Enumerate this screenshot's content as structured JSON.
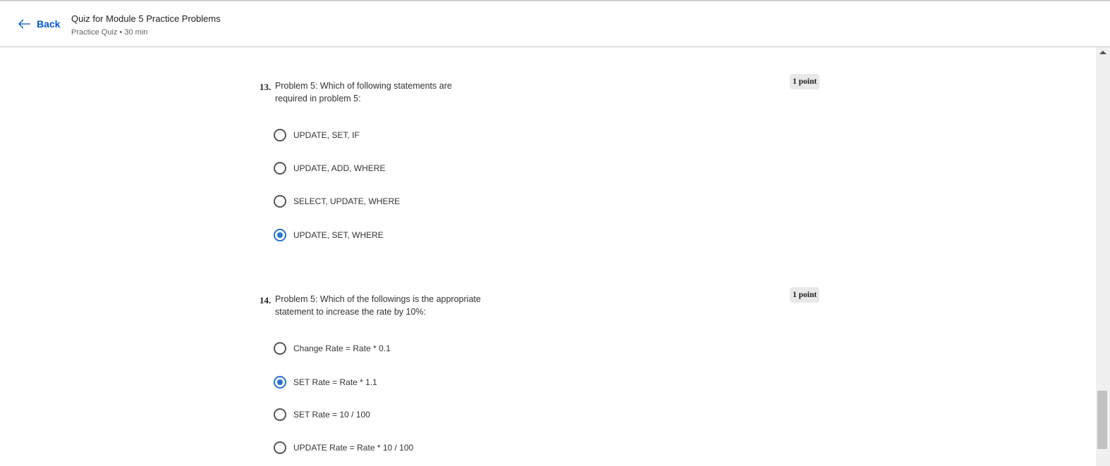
{
  "header": {
    "back_label": "Back",
    "title": "Quiz for Module 5 Practice Problems",
    "subtitle": "Practice Quiz • 30 min"
  },
  "questions": [
    {
      "number": "13.",
      "text": "Problem 5: Which of following statements are required in problem 5:",
      "points": "1 point",
      "options": [
        {
          "label": "UPDATE, SET, IF",
          "selected": false
        },
        {
          "label": "UPDATE, ADD, WHERE",
          "selected": false
        },
        {
          "label": "SELECT, UPDATE, WHERE",
          "selected": false
        },
        {
          "label": "UPDATE, SET, WHERE",
          "selected": true
        }
      ]
    },
    {
      "number": "14.",
      "text": "Problem 5: Which of the followings is the appropriate statement to increase the rate by 10%:",
      "points": "1 point",
      "options": [
        {
          "label": "Change Rate = Rate * 0.1",
          "selected": false
        },
        {
          "label": "SET Rate = Rate * 1.1",
          "selected": true
        },
        {
          "label": "SET Rate = 10 / 100",
          "selected": false
        },
        {
          "label": "UPDATE Rate = Rate * 10 / 100",
          "selected": false
        }
      ]
    }
  ]
}
